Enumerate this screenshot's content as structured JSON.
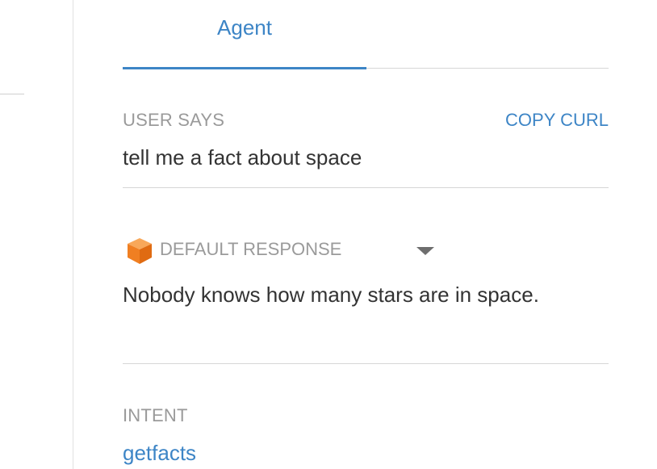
{
  "tabs": {
    "agent_label": "Agent"
  },
  "user_says": {
    "label": "USER SAYS",
    "copy_curl_label": "COPY CURL",
    "query": "tell me a fact about space"
  },
  "response": {
    "icon": "cube-icon",
    "label": "DEFAULT RESPONSE",
    "text": "Nobody knows how many stars are in space."
  },
  "intent": {
    "label": "INTENT",
    "value": "getfacts"
  },
  "colors": {
    "accent": "#3d85c6",
    "muted_label": "#9a9a9a",
    "body_text": "#333333",
    "divider": "#d6d6d6",
    "cube_orange": "#f5923e"
  }
}
